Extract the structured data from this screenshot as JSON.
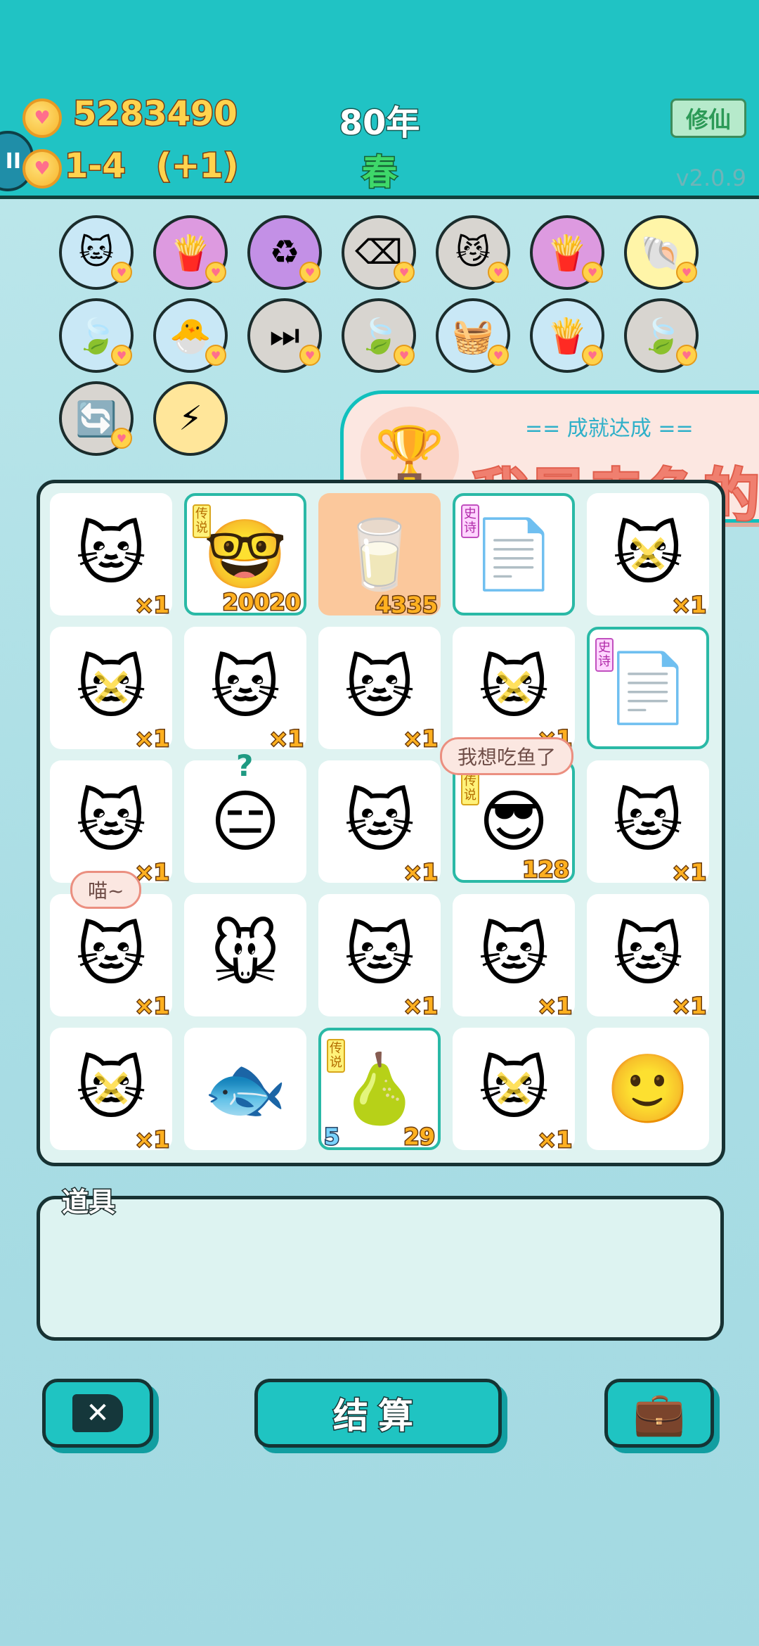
{
  "header": {
    "coins": "5283490",
    "hearts": "1-4",
    "hearts_bonus": "(+1)",
    "year": "80年",
    "season": "春",
    "mode_button": "修仙",
    "version": "v2.0.9"
  },
  "skills": [
    {
      "icon": "cat-icon",
      "glyph": "🐱",
      "bg": "#c9e8f6"
    },
    {
      "icon": "fries-icon",
      "glyph": "🍟",
      "bg": "#dd9ae0"
    },
    {
      "icon": "recycle-icon",
      "glyph": "♻",
      "bg": "#c390e6"
    },
    {
      "icon": "delete-icon",
      "glyph": "⌫",
      "bg": "#d8d5d0"
    },
    {
      "icon": "twin-cats-icon",
      "glyph": "😼",
      "bg": "#d8d5d0"
    },
    {
      "icon": "fries-icon",
      "glyph": "🍟",
      "bg": "#dd9ae0"
    },
    {
      "icon": "shell-icon",
      "glyph": "🐚",
      "bg": "#fff5a8"
    },
    {
      "icon": "leaf-icon",
      "glyph": "🍃",
      "bg": "#c9e8f6"
    },
    {
      "icon": "chick-icon",
      "glyph": "🐣",
      "bg": "#c9e8f6"
    },
    {
      "icon": "skip-icon",
      "glyph": "⏭",
      "bg": "#d8d5d0"
    },
    {
      "icon": "leaf-icon",
      "glyph": "🍃",
      "bg": "#d8d5d0"
    },
    {
      "icon": "fruit-basket-icon",
      "glyph": "🧺",
      "bg": "#c9e8f6"
    },
    {
      "icon": "fries-icon",
      "glyph": "🍟",
      "bg": "#c9e8f6"
    },
    {
      "icon": "leaf-icon",
      "glyph": "🍃",
      "bg": "#d8d5d0"
    },
    {
      "icon": "refresh-icon",
      "glyph": "🔄",
      "bg": "#d8d5d0"
    },
    {
      "icon": "lightning-icon",
      "glyph": "⚡",
      "bg": "#ffe69a"
    }
  ],
  "achievement": {
    "subtitle": "== 成就达成 ==",
    "title": "我是卖鱼的"
  },
  "board": [
    {
      "icon": "cat-icon",
      "glyph": "🐱",
      "count": "×1"
    },
    {
      "icon": "king-grandpa-icon",
      "glyph": "🤓",
      "count": "20020",
      "tag": "传说",
      "legend": true
    },
    {
      "icon": "water-glass-icon",
      "glyph": "🥛",
      "count": "4335",
      "orange": true
    },
    {
      "icon": "copy-paste-icon",
      "glyph": "📄",
      "count": "",
      "tag": "史诗",
      "epic": true,
      "legend": true
    },
    {
      "icon": "cat-crossed-icon",
      "glyph": "🐱",
      "count": "×1",
      "crossed": true
    },
    {
      "icon": "cat-crossed-icon",
      "glyph": "🐱",
      "count": "×1",
      "crossed": true
    },
    {
      "icon": "cat-icon",
      "glyph": "🐱",
      "count": "×1"
    },
    {
      "icon": "cat-icon",
      "glyph": "🐱",
      "count": "×1"
    },
    {
      "icon": "cat-crossed-icon",
      "glyph": "🐱",
      "count": "×1",
      "crossed": true
    },
    {
      "icon": "copy-paste-icon",
      "glyph": "📄",
      "count": "",
      "tag": "史诗",
      "epic": true,
      "legend": true
    },
    {
      "icon": "cat-icon",
      "glyph": "🐱",
      "count": "×1"
    },
    {
      "icon": "bucket-hat-man-icon",
      "glyph": "😑",
      "count": ""
    },
    {
      "icon": "cat-icon",
      "glyph": "🐱",
      "count": "×1"
    },
    {
      "icon": "sunglasses-man-icon",
      "glyph": "😎",
      "count": "128",
      "tag": "传说",
      "legend": true
    },
    {
      "icon": "cat-icon",
      "glyph": "🐱",
      "count": "×1"
    },
    {
      "icon": "cat-icon",
      "glyph": "🐱",
      "count": "×1"
    },
    {
      "icon": "mouse-icon",
      "glyph": "🐭",
      "count": ""
    },
    {
      "icon": "cat-icon",
      "glyph": "🐱",
      "count": "×1"
    },
    {
      "icon": "cat-icon",
      "glyph": "🐱",
      "count": "×1"
    },
    {
      "icon": "cat-icon",
      "glyph": "🐱",
      "count": "×1"
    },
    {
      "icon": "cat-crossed-icon",
      "glyph": "🐱",
      "count": "×1",
      "crossed": true
    },
    {
      "icon": "fish-icon",
      "glyph": "🐟",
      "count": ""
    },
    {
      "icon": "pear-king-icon",
      "glyph": "🍐",
      "count": "29",
      "left_count": "5",
      "tag": "传说",
      "legend": true
    },
    {
      "icon": "cat-crossed-icon",
      "glyph": "🐱",
      "count": "×1",
      "crossed": true
    },
    {
      "icon": "red-cap-boy-icon",
      "glyph": "🙂",
      "count": ""
    }
  ],
  "bubbles": {
    "fish_wish": "我想吃鱼了",
    "meow": "喵~",
    "confused": "?"
  },
  "props": {
    "label": "道具"
  },
  "buttons": {
    "settle": "结算"
  }
}
